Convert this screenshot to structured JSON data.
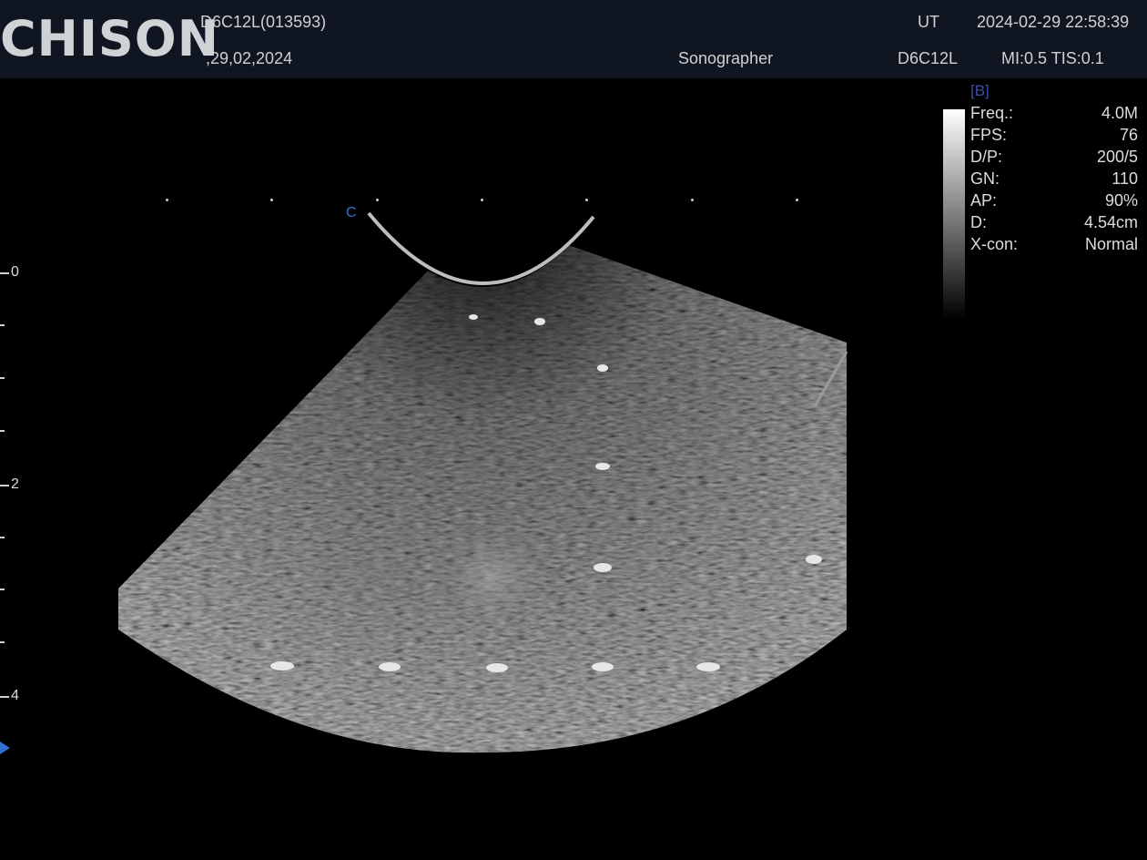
{
  "header": {
    "brand": "CHISON",
    "probe_id": "D6C12L(013593)",
    "patient_date": ",29,02,2024",
    "operator": "Sonographer",
    "probe": "D6C12L",
    "institution": "UT",
    "datetime": "2024-02-29 22:58:39",
    "indices": "MI:0.5 TIS:0.1"
  },
  "panel": {
    "mode": "[B]",
    "params": [
      {
        "key": "Freq.:",
        "value": "4.0M"
      },
      {
        "key": "FPS:",
        "value": "76"
      },
      {
        "key": "D/P:",
        "value": "200/5"
      },
      {
        "key": "GN:",
        "value": "110"
      },
      {
        "key": "AP:",
        "value": "90%"
      },
      {
        "key": "D:",
        "value": "4.54cm"
      },
      {
        "key": "X-con:",
        "value": "Normal"
      }
    ]
  },
  "depth_scale": {
    "labels": [
      "0",
      "2",
      "4"
    ]
  },
  "image": {
    "orientation_marker": "C"
  },
  "colors": {
    "header_bg": "#0f1622",
    "accent_blue": "#2e6fd0",
    "mode_label": "#3a4ea8"
  }
}
